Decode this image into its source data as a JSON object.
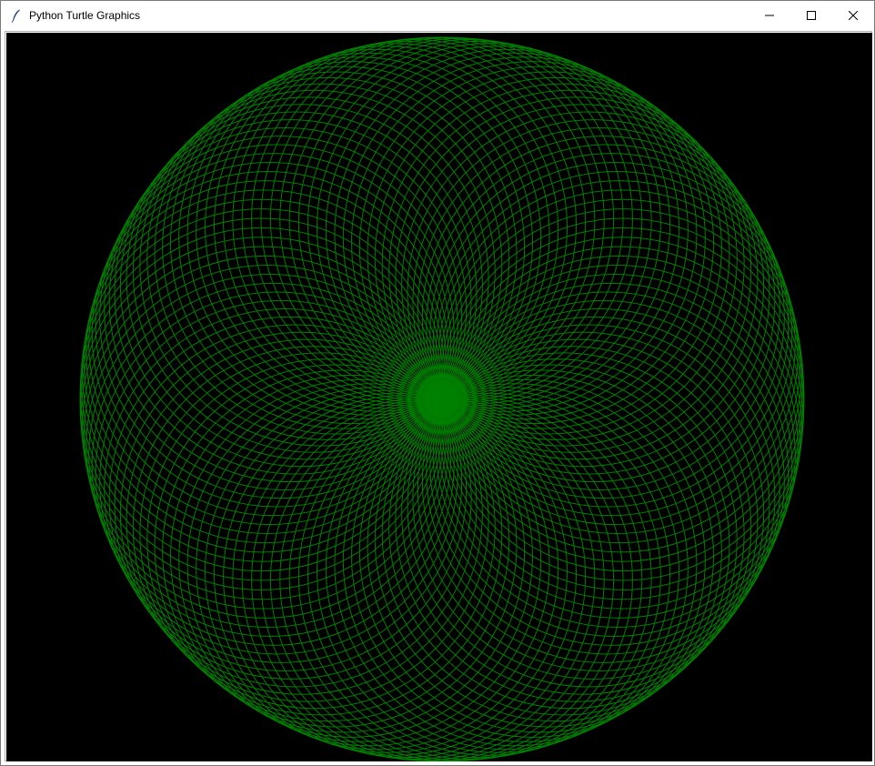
{
  "window": {
    "title": "Python Turtle Graphics",
    "app_icon": "feather-icon",
    "controls": {
      "minimize_icon": "minimize-icon",
      "maximize_icon": "maximize-icon",
      "close_icon": "close-icon"
    }
  },
  "canvas": {
    "background": "#000000",
    "pen_color": "#008000",
    "pattern": "circles"
  }
}
